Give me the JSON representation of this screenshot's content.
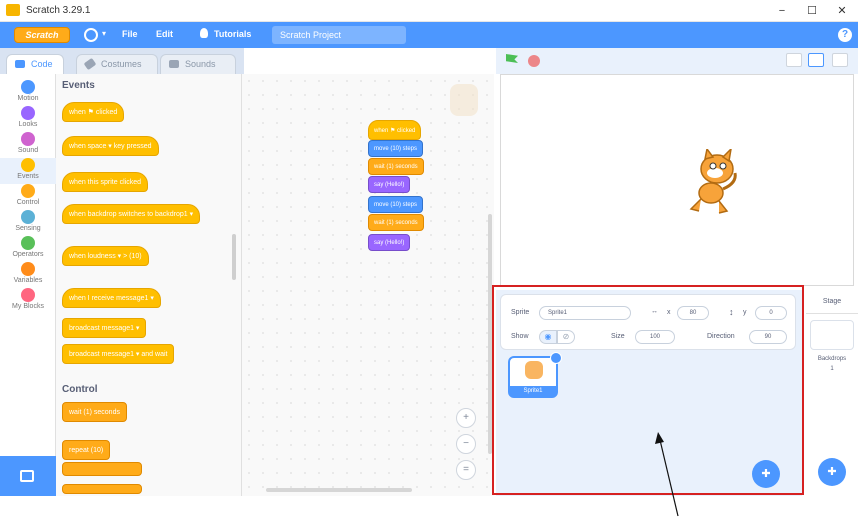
{
  "window": {
    "title": "Scratch 3.29.1",
    "minimize": "−",
    "maximize": "☐",
    "close": "✕"
  },
  "menubar": {
    "logo": "Scratch",
    "language_caret": "▾",
    "file": "File",
    "edit": "Edit",
    "tutorials": "Tutorials",
    "project_title": "Scratch Project",
    "help": "?"
  },
  "tabs": {
    "code": "Code",
    "costumes": "Costumes",
    "sounds": "Sounds"
  },
  "categories": [
    {
      "label": "Motion",
      "color": "#4c97ff"
    },
    {
      "label": "Looks",
      "color": "#9966ff"
    },
    {
      "label": "Sound",
      "color": "#cf63cf"
    },
    {
      "label": "Events",
      "color": "#ffbf00"
    },
    {
      "label": "Control",
      "color": "#ffab19"
    },
    {
      "label": "Sensing",
      "color": "#5cb1d6"
    },
    {
      "label": "Operators",
      "color": "#59c059"
    },
    {
      "label": "Variables",
      "color": "#ff8c1a"
    },
    {
      "label": "My Blocks",
      "color": "#ff6680"
    }
  ],
  "palette": {
    "events_heading": "Events",
    "control_heading": "Control",
    "events_blocks": [
      {
        "text": "when ⚑ clicked"
      },
      {
        "text": "when  space ▾  key pressed"
      },
      {
        "text": "when this sprite clicked"
      },
      {
        "text": "when backdrop switches to  backdrop1 ▾"
      },
      {
        "text": "when  loudness ▾  >  (10)"
      },
      {
        "text": "when I receive  message1 ▾"
      },
      {
        "text": "broadcast  message1 ▾"
      },
      {
        "text": "broadcast  message1 ▾  and wait"
      }
    ],
    "control_blocks": [
      {
        "text": "wait  (1)  seconds"
      },
      {
        "text": "repeat  (10)"
      }
    ]
  },
  "script": [
    {
      "text": "when ⚑ clicked",
      "category": "events"
    },
    {
      "text": "move  (10)  steps",
      "category": "motion"
    },
    {
      "text": "wait  (1)  seconds",
      "category": "control"
    },
    {
      "text": "say  (Hello!)",
      "category": "looks"
    },
    {
      "text": "move  (10)  steps",
      "category": "motion"
    },
    {
      "text": "wait  (1)  seconds",
      "category": "control"
    },
    {
      "text": "say  (Hello!)",
      "category": "looks"
    }
  ],
  "zoom": {
    "in": "+",
    "out": "−",
    "reset": "="
  },
  "sprite_info": {
    "sprite_label": "Sprite",
    "sprite_name": "Sprite1",
    "x_label": "x",
    "x_value": "80",
    "y_label": "y",
    "y_value": "0",
    "show_label": "Show",
    "size_label": "Size",
    "size_value": "100",
    "direction_label": "Direction",
    "direction_value": "90"
  },
  "sprite_list": [
    {
      "name": "Sprite1"
    }
  ],
  "stage_pane": {
    "title": "Stage",
    "backdrops_label": "Backdrops",
    "backdrops_count": "1"
  }
}
